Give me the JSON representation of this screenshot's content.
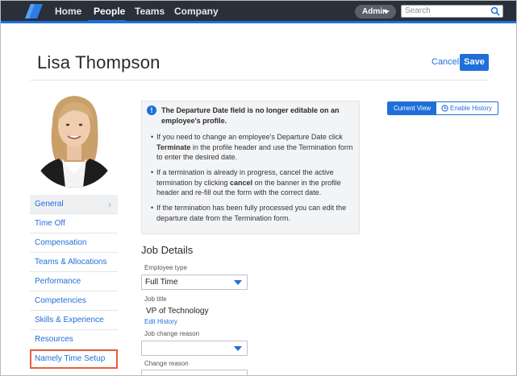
{
  "nav": {
    "items": [
      "Home",
      "People",
      "Teams",
      "Company"
    ],
    "active": "People",
    "admin_label": "Admin",
    "search_placeholder": "Search"
  },
  "header": {
    "name": "Lisa Thompson",
    "cancel_label": "Cancel",
    "save_label": "Save"
  },
  "sidebar": {
    "items": [
      {
        "label": "General",
        "active": true
      },
      {
        "label": "Time Off"
      },
      {
        "label": "Compensation"
      },
      {
        "label": "Teams & Allocations"
      },
      {
        "label": "Performance"
      },
      {
        "label": "Competencies"
      },
      {
        "label": "Skills & Experience"
      },
      {
        "label": "Resources"
      },
      {
        "label": "Namely Time Setup",
        "highlighted": true
      }
    ]
  },
  "info": {
    "title": "The Departure Date field is no longer editable on an employee's profile.",
    "bullet1_a": "If you need to change an employee's Departure Date click ",
    "bullet1_b": "Terminate",
    "bullet1_c": " in the profile header and use the Termination form to enter the desired date.",
    "bullet2_a": "If a termination is already in progress, cancel the active termination by clicking ",
    "bullet2_b": "cancel",
    "bullet2_c": " on the banner in the profile header and re-fill out the form with the correct date.",
    "bullet3": "If the termination has been fully processed you can edit the departure date from the Termination form."
  },
  "view_toggle": {
    "current_label": "Current View",
    "history_label": "Enable History"
  },
  "job_details": {
    "title": "Job Details",
    "employee_type_label": "Employee type",
    "employee_type_value": "Full Time",
    "job_title_label": "Job title",
    "job_title_value": "VP of Technology",
    "edit_history_label": "Edit History",
    "job_change_reason_label": "Job change reason",
    "job_change_reason_value": "",
    "change_reason_label": "Change reason"
  },
  "colors": {
    "nav_bg": "#293039",
    "accent": "#1f6fd9",
    "highlight_border": "#e8603c"
  }
}
